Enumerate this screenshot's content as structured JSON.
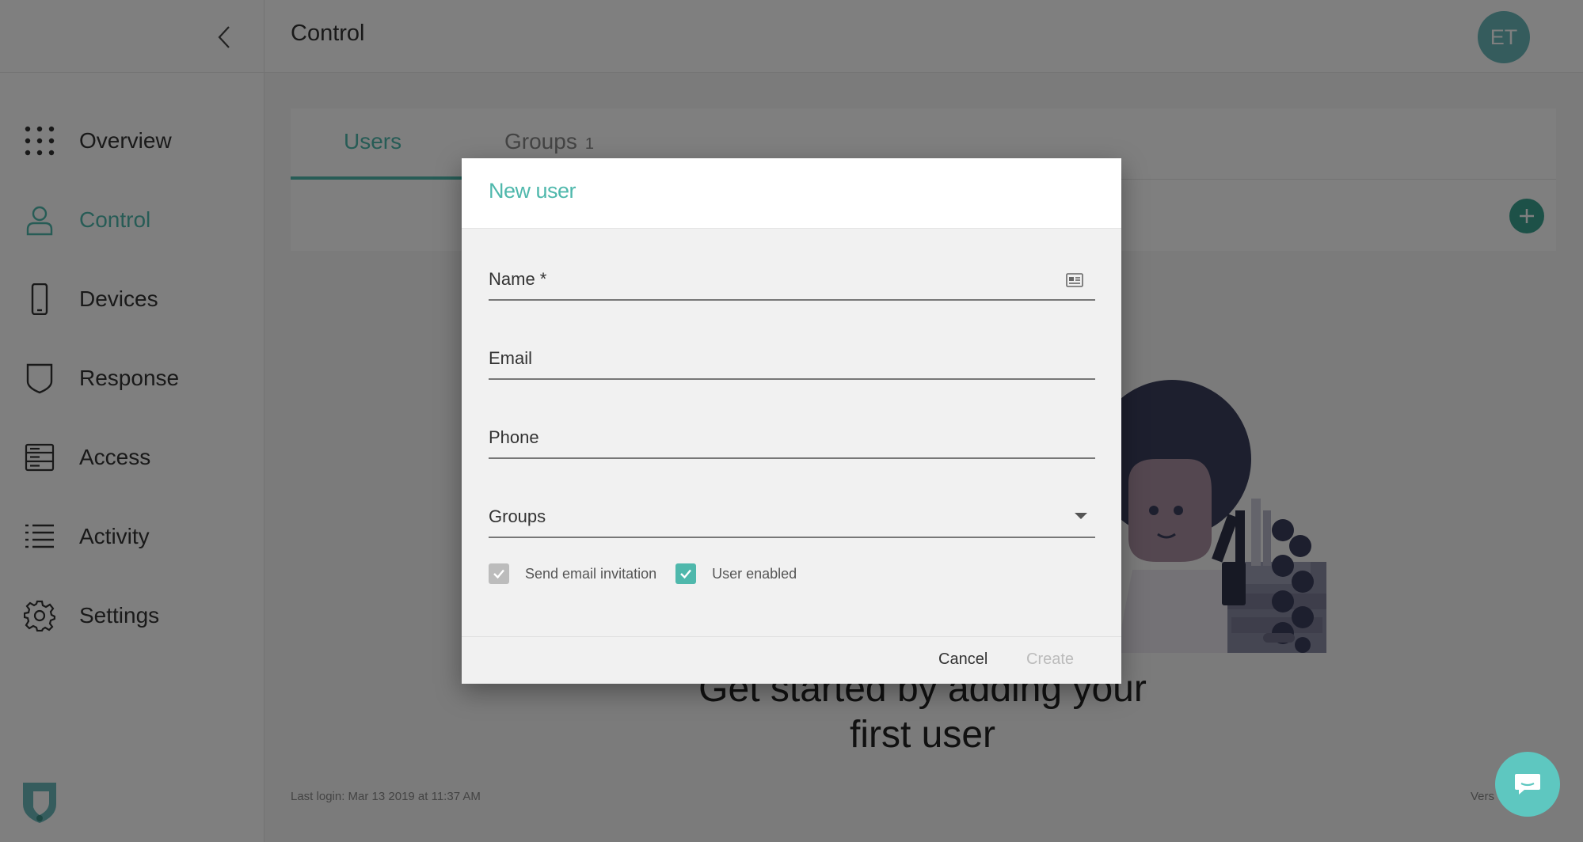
{
  "topbar": {
    "title": "Control",
    "avatar_initials": "ET"
  },
  "sidebar": {
    "items": [
      {
        "label": "Overview",
        "icon": "grid-dots-icon",
        "active": false
      },
      {
        "label": "Control",
        "icon": "user-icon",
        "active": true
      },
      {
        "label": "Devices",
        "icon": "phone-icon",
        "active": false
      },
      {
        "label": "Response",
        "icon": "shield-icon",
        "active": false
      },
      {
        "label": "Access",
        "icon": "server-icon",
        "active": false
      },
      {
        "label": "Activity",
        "icon": "list-icon",
        "active": false
      },
      {
        "label": "Settings",
        "icon": "gear-icon",
        "active": false
      }
    ]
  },
  "main": {
    "tabs": [
      {
        "label": "Users",
        "active": true
      },
      {
        "label": "Groups",
        "count": "1",
        "active": false
      }
    ],
    "empty_state_line1": "Get started by adding your",
    "empty_state_line2": "first user",
    "last_login": "Last login: Mar 13 2019 at 11:37 AM",
    "version_text": "Vers"
  },
  "dialog": {
    "title": "New user",
    "fields": {
      "name_label": "Name *",
      "email_label": "Email",
      "phone_label": "Phone",
      "groups_label": "Groups"
    },
    "checkboxes": {
      "send_invitation_label": "Send email invitation",
      "send_invitation_checked": true,
      "user_enabled_label": "User enabled",
      "user_enabled_checked": true
    },
    "cancel_label": "Cancel",
    "create_label": "Create"
  },
  "colors": {
    "accent": "#4fb8ac",
    "overlay": "rgba(0,0,0,0.5)",
    "create_disabled": "#bbbbbb"
  }
}
